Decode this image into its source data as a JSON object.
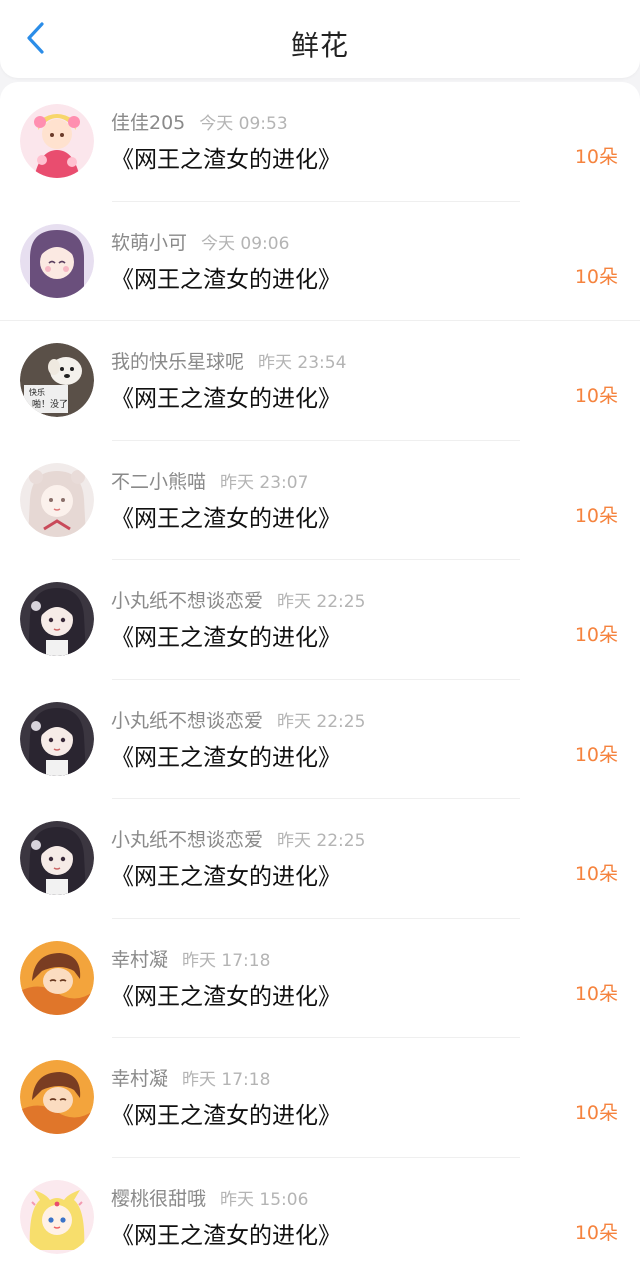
{
  "header": {
    "title": "鲜花",
    "back_icon": "chevron-left-icon",
    "accent_color": "#2b8de8"
  },
  "amount_color": "#f5833e",
  "gifts": [
    {
      "user": "佳佳205",
      "time": "今天 09:53",
      "book": "《网王之渣女的进化》",
      "amount": "10朵",
      "avatar": "anime-girl-pink"
    },
    {
      "user": "软萌小可",
      "time": "今天 09:06",
      "book": "《网王之渣女的进化》",
      "amount": "10朵",
      "avatar": "anime-girl-purple"
    },
    {
      "user": "我的快乐星球呢",
      "time": "昨天 23:54",
      "book": "《网王之渣女的进化》",
      "amount": "10朵",
      "avatar": "dog-meme"
    },
    {
      "user": "不二小熊喵",
      "time": "昨天 23:07",
      "book": "《网王之渣女的进化》",
      "amount": "10朵",
      "avatar": "anime-girl-bear"
    },
    {
      "user": "小丸纸不想谈恋爱",
      "time": "昨天 22:25",
      "book": "《网王之渣女的进化》",
      "amount": "10朵",
      "avatar": "anime-girl-dark"
    },
    {
      "user": "小丸纸不想谈恋爱",
      "time": "昨天 22:25",
      "book": "《网王之渣女的进化》",
      "amount": "10朵",
      "avatar": "anime-girl-dark"
    },
    {
      "user": "小丸纸不想谈恋爱",
      "time": "昨天 22:25",
      "book": "《网王之渣女的进化》",
      "amount": "10朵",
      "avatar": "anime-girl-dark"
    },
    {
      "user": "幸村凝",
      "time": "昨天 17:18",
      "book": "《网王之渣女的进化》",
      "amount": "10朵",
      "avatar": "anime-boy-orange"
    },
    {
      "user": "幸村凝",
      "time": "昨天 17:18",
      "book": "《网王之渣女的进化》",
      "amount": "10朵",
      "avatar": "anime-boy-orange"
    },
    {
      "user": "樱桃很甜哦",
      "time": "昨天 15:06",
      "book": "《网王之渣女的进化》",
      "amount": "10朵",
      "avatar": "sailor-moon"
    }
  ]
}
